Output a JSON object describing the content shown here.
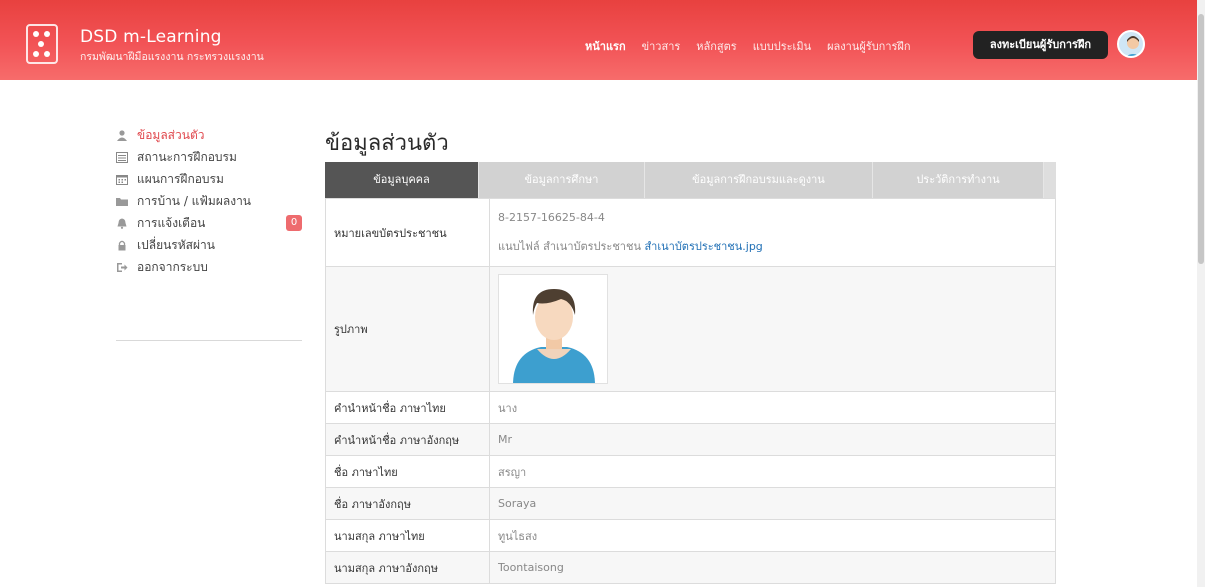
{
  "brand": {
    "title": "DSD m-Learning",
    "subtitle": "กรมพัฒนาฝีมือแรงงาน กระทรวงแรงงาน"
  },
  "nav": {
    "items": [
      "หน้าแรก",
      "ข่าวสาร",
      "หลักสูตร",
      "แบบประเมิน",
      "ผลงานผู้รับการฝึก"
    ],
    "register_label": "ลงทะเบียนผู้รับการฝึก"
  },
  "sidebar": {
    "items": [
      {
        "label": "ข้อมูลส่วนตัว",
        "icon": "user-icon"
      },
      {
        "label": "สถานะการฝึกอบรม",
        "icon": "list-icon"
      },
      {
        "label": "แผนการฝึกอบรม",
        "icon": "calendar-icon"
      },
      {
        "label": "การบ้าน / แฟ้มผลงาน",
        "icon": "folder-icon"
      },
      {
        "label": "การแจ้งเตือน",
        "icon": "bell-icon",
        "badge": "0"
      },
      {
        "label": "เปลี่ยนรหัสผ่าน",
        "icon": "lock-icon"
      },
      {
        "label": "ออกจากระบบ",
        "icon": "logout-icon"
      }
    ]
  },
  "main": {
    "title": "ข้อมูลส่วนตัว",
    "tabs": [
      "ข้อมูลบุคคล",
      "ข้อมูลการศึกษา",
      "ข้อมูลการฝึกอบรมและดูงาน",
      "ประวัติการทำงาน"
    ],
    "id_row": {
      "label": "หมายเลขบัตรประชาชน",
      "value": "8-2157-16625-84-4",
      "file_prefix": "แนบไฟล์ สำเนาบัตรประชาชน",
      "file_link": "สำเนาบัตรประชาชน.jpg"
    },
    "photo_row": {
      "label": "รูปภาพ"
    },
    "rows": [
      {
        "label": "คำนำหน้าชื่อ ภาษาไทย",
        "value": "นาง"
      },
      {
        "label": "คำนำหน้าชื่อ ภาษาอังกฤษ",
        "value": "Mr"
      },
      {
        "label": "ชื่อ ภาษาไทย",
        "value": "สรญา"
      },
      {
        "label": "ชื่อ ภาษาอังกฤษ",
        "value": "Soraya"
      },
      {
        "label": "นามสกุล ภาษาไทย",
        "value": "ทูนไธสง"
      },
      {
        "label": "นามสกุล ภาษาอังกฤษ",
        "value": "Toontaisong"
      }
    ]
  },
  "colors": {
    "header_gradient_top": "#e8413f",
    "header_gradient_bottom": "#f76c6b",
    "accent": "#e0474c",
    "link": "#1f6fb5",
    "active_tab": "#555555"
  }
}
